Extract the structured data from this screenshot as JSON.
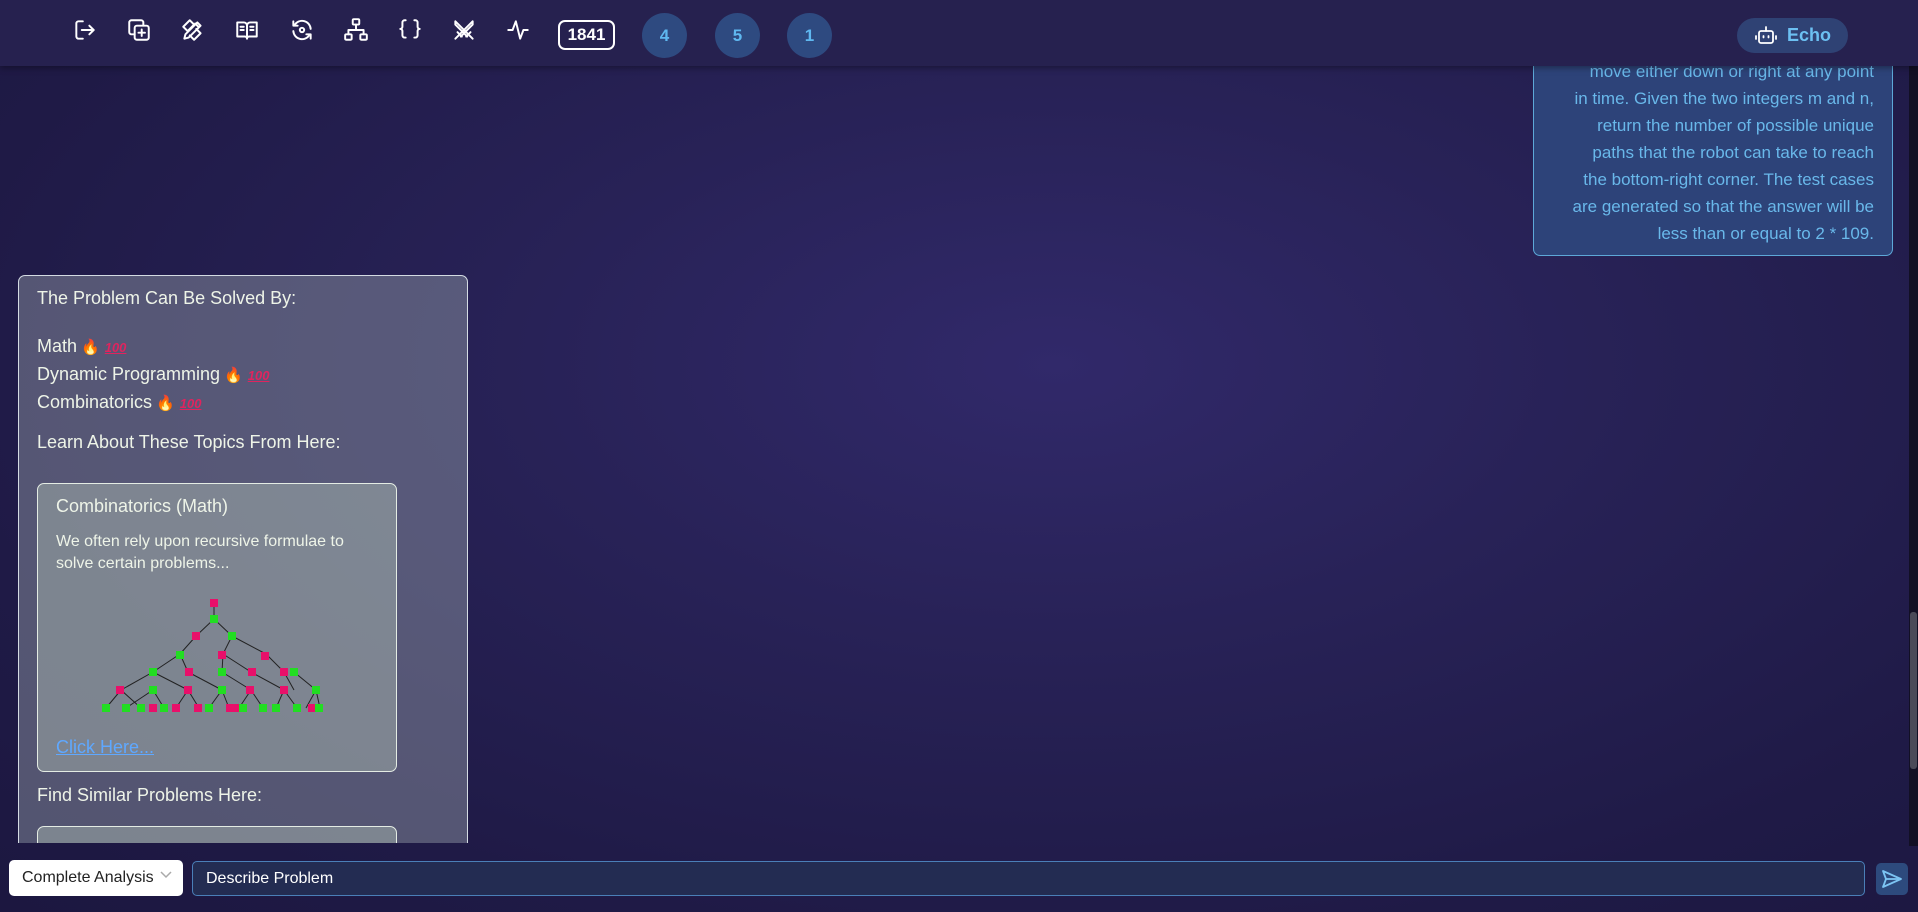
{
  "toolbar": {
    "icons": [
      "logout-icon",
      "copy-add-icon",
      "pencil-ruler-icon",
      "book-open-icon",
      "refresh-icon",
      "sitemap-icon",
      "braces-icon",
      "crossed-swords-icon",
      "pulse-icon"
    ],
    "count_badge": "1841",
    "circle_badges": [
      "4",
      "5",
      "1"
    ],
    "echo_label": "Echo"
  },
  "user_message": {
    "lines": [
      "move either down or right at any point",
      "in time. Given the two integers m and n,",
      "return the number of possible unique",
      "paths that the robot can take to reach",
      "the bottom-right corner. The test cases",
      "are generated so that the answer will be",
      "less than or equal to 2 * 109."
    ]
  },
  "analysis": {
    "heading": "The Problem Can Be Solved By:",
    "topics": [
      "Math",
      "Dynamic Programming",
      "Combinatorics"
    ],
    "learn_heading": "Learn About These Topics From Here:",
    "topic_card": {
      "title": "Combinatorics (Math)",
      "description": "We often rely upon recursive formulae to solve certain problems...",
      "link": "Click Here..."
    },
    "similar_heading": "Find Similar Problems Here:"
  },
  "input_bar": {
    "mode": "Complete Analysis",
    "placeholder": "Describe Problem"
  },
  "colors": {
    "accent_blue": "#69b8ea",
    "tree_green": "#22dd22",
    "tree_pink": "#e8106a"
  }
}
